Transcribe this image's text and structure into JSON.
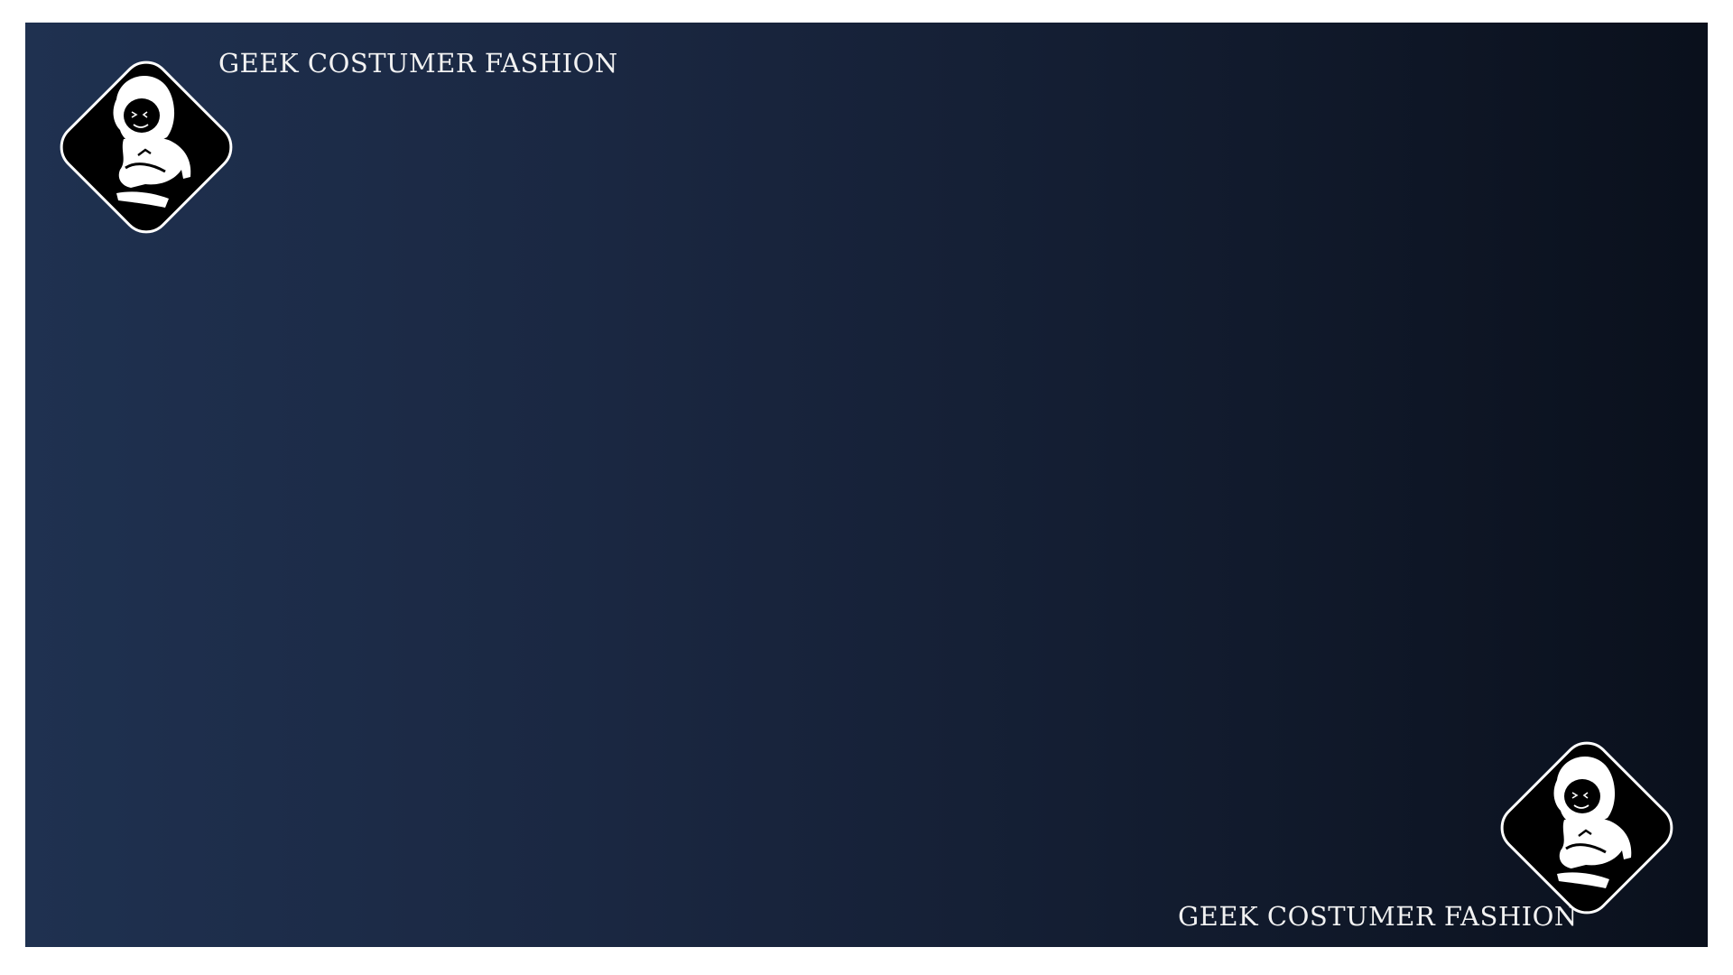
{
  "brand": {
    "top_text": "GEEK COSTUMER FASHION",
    "bottom_text": "GEEK COSTUMER FASHION"
  },
  "logo": {
    "icon": "hooded-figure-logo",
    "fill": "#000000",
    "outline": "#ffffff"
  },
  "background": {
    "gradient_start": "#1f3150",
    "gradient_end": "#0a101c",
    "frame": "#ffffff"
  }
}
